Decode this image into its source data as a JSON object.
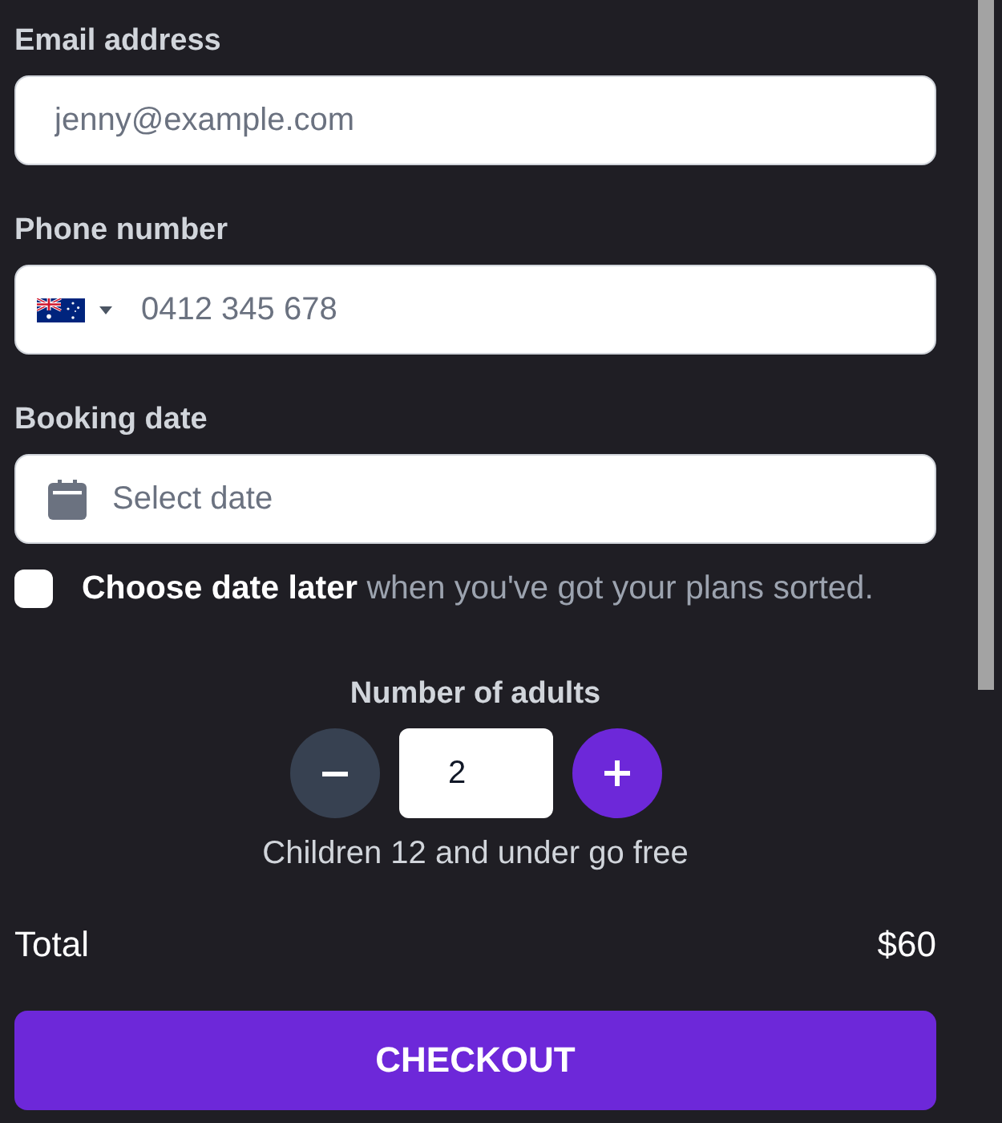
{
  "fields": [
    {
      "kind": "email",
      "label": "Email address",
      "placeholder": "jenny@example.com"
    },
    {
      "kind": "phone",
      "label": "Phone number",
      "placeholder": "0412 345 678"
    },
    {
      "kind": "date",
      "label": "Booking date",
      "placeholder": "Select date"
    }
  ],
  "date_later": {
    "checked": false,
    "text": "**Choose date later** when you've got your plans sorted."
  },
  "adults": {
    "label": "Number of adults",
    "value": "2",
    "note": "Children 12 and under go free"
  },
  "total": {
    "label": "Total",
    "amount": "$60"
  },
  "checkout_button": "CHECKOUT"
}
